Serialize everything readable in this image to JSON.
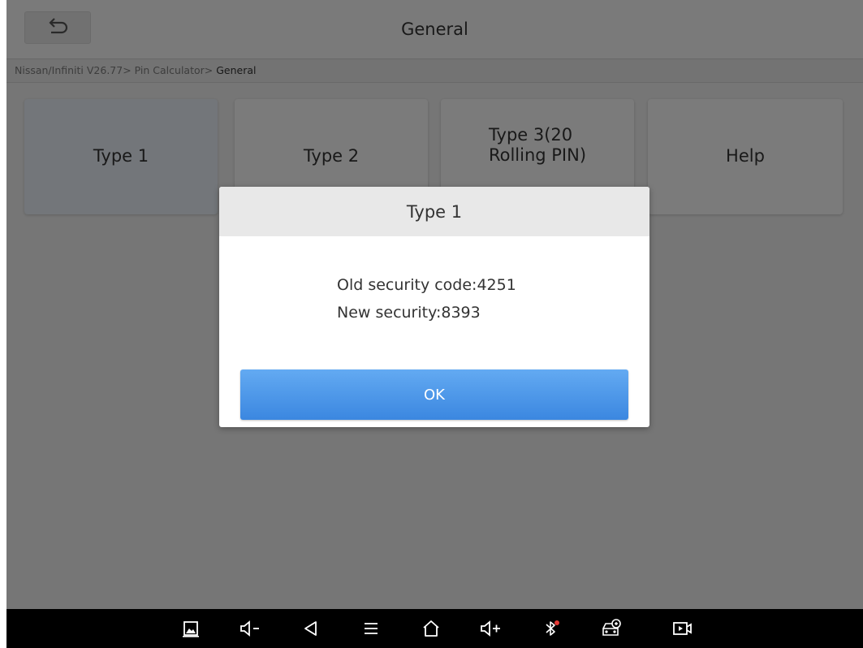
{
  "header": {
    "title": "General",
    "back_icon": "undo-arrow-icon"
  },
  "breadcrumb": {
    "path": "Nissan/Infiniti V26.77> Pin Calculator> ",
    "current": "General"
  },
  "menu": {
    "tiles": [
      {
        "label": "Type 1",
        "selected": true
      },
      {
        "label": "Type 2",
        "selected": false
      },
      {
        "label_line1": "Type 3(20",
        "label_line2": "Rolling PIN)",
        "selected": false
      },
      {
        "label": "Help",
        "selected": false
      }
    ]
  },
  "dialog": {
    "title": "Type 1",
    "line1": "Old security code:4251",
    "line2": "New security:8393",
    "ok_label": "OK"
  },
  "navbar": {
    "icons": [
      "gallery-icon",
      "volume-down-icon",
      "back-icon",
      "menu-icon",
      "home-icon",
      "volume-up-icon",
      "bluetooth-icon",
      "vci-car-icon",
      "screen-record-icon"
    ]
  },
  "colors": {
    "ok_button": "#4a98ea",
    "overlay": "#000000",
    "navbar": "#000000"
  }
}
